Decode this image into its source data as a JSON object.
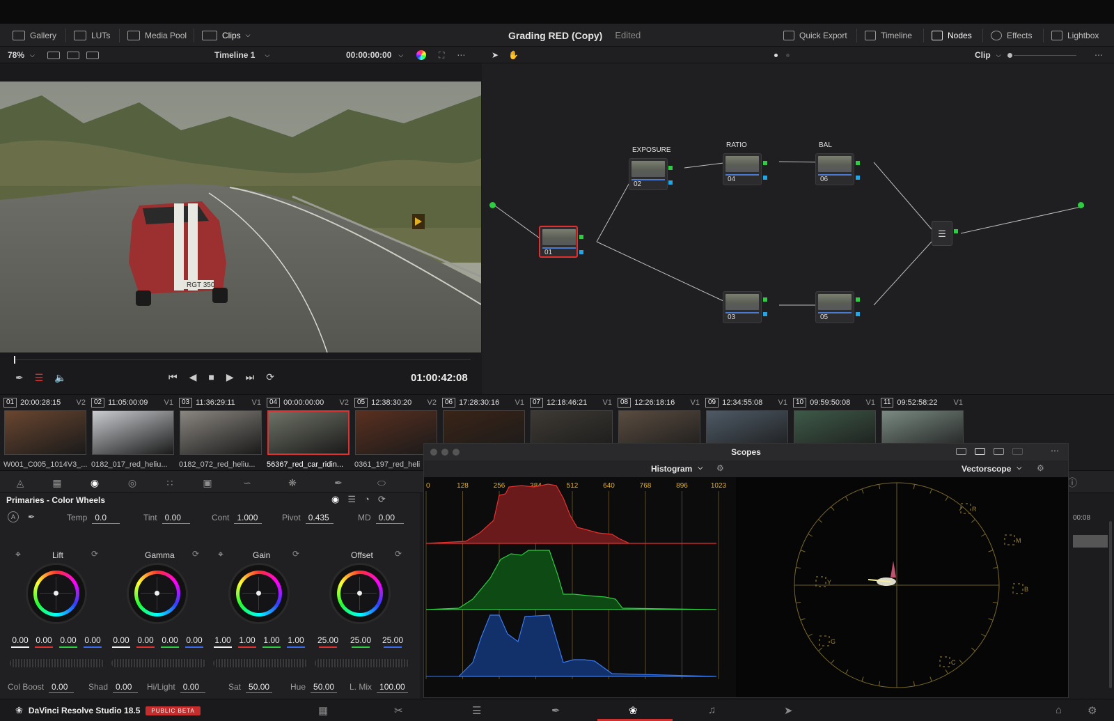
{
  "topbar": {
    "gallery": "Gallery",
    "luts": "LUTs",
    "media_pool": "Media Pool",
    "clips": "Clips",
    "project_title": "Grading RED (Copy)",
    "project_status": "Edited",
    "quick_export": "Quick Export",
    "timeline": "Timeline",
    "nodes": "Nodes",
    "effects": "Effects",
    "lightbox": "Lightbox"
  },
  "viewer": {
    "zoom": "78%",
    "timeline_name": "Timeline 1",
    "source_timecode": "00:00:00:00",
    "current_timecode": "01:00:42:08"
  },
  "nodebar": {
    "mode": "Clip"
  },
  "nodes": [
    {
      "num": "01",
      "label": ""
    },
    {
      "num": "02",
      "label": "EXPOSURE"
    },
    {
      "num": "04",
      "label": "RATIO"
    },
    {
      "num": "06",
      "label": "BAL"
    },
    {
      "num": "03",
      "label": ""
    },
    {
      "num": "05",
      "label": ""
    }
  ],
  "clips": [
    {
      "num": "01",
      "tc": "20:00:28:15",
      "track": "V2",
      "name": "W001_C005_1014V3_..."
    },
    {
      "num": "02",
      "tc": "11:05:00:09",
      "track": "V1",
      "name": "0182_017_red_heliu..."
    },
    {
      "num": "03",
      "tc": "11:36:29:11",
      "track": "V1",
      "name": "0182_072_red_heliu..."
    },
    {
      "num": "04",
      "tc": "00:00:00:00",
      "track": "V2",
      "name": "56367_red_car_ridin..."
    },
    {
      "num": "05",
      "tc": "12:38:30:20",
      "track": "V2",
      "name": "0361_197_red_heli"
    },
    {
      "num": "06",
      "tc": "17:28:30:16",
      "track": "V1",
      "name": ""
    },
    {
      "num": "07",
      "tc": "12:18:46:21",
      "track": "V1",
      "name": ""
    },
    {
      "num": "08",
      "tc": "12:26:18:16",
      "track": "V1",
      "name": ""
    },
    {
      "num": "09",
      "tc": "12:34:55:08",
      "track": "V1",
      "name": ""
    },
    {
      "num": "10",
      "tc": "09:59:50:08",
      "track": "V1",
      "name": ""
    },
    {
      "num": "11",
      "tc": "09:52:58:22",
      "track": "V1",
      "name": ""
    }
  ],
  "primaries": {
    "title": "Primaries - Color Wheels",
    "temp_label": "Temp",
    "temp": "0.0",
    "tint_label": "Tint",
    "tint": "0.00",
    "cont_label": "Cont",
    "cont": "1.000",
    "pivot_label": "Pivot",
    "pivot": "0.435",
    "md_label": "MD",
    "md": "0.00",
    "wheels": [
      {
        "name": "Lift",
        "values": [
          "0.00",
          "0.00",
          "0.00",
          "0.00"
        ]
      },
      {
        "name": "Gamma",
        "values": [
          "0.00",
          "0.00",
          "0.00",
          "0.00"
        ]
      },
      {
        "name": "Gain",
        "values": [
          "1.00",
          "1.00",
          "1.00",
          "1.00"
        ]
      },
      {
        "name": "Offset",
        "values": [
          "25.00",
          "25.00",
          "25.00"
        ]
      }
    ],
    "col_boost_label": "Col Boost",
    "col_boost": "0.00",
    "shad_label": "Shad",
    "shad": "0.00",
    "hilight_label": "Hi/Light",
    "hilight": "0.00",
    "sat_label": "Sat",
    "sat": "50.00",
    "hue_label": "Hue",
    "hue": "50.00",
    "lmix_label": "L. Mix",
    "lmix": "100.00"
  },
  "scopes": {
    "title": "Scopes",
    "left_scope": "Histogram",
    "right_scope": "Vectorscope",
    "ticks": [
      "0",
      "128",
      "256",
      "384",
      "512",
      "640",
      "768",
      "896",
      "1023"
    ],
    "vector_targets": [
      "R",
      "M",
      "B",
      "C",
      "G",
      "Y"
    ]
  },
  "right_panel": {
    "tc": "00:08"
  },
  "status": {
    "app": "DaVinci Resolve Studio 18.5",
    "badge": "PUBLIC BETA"
  },
  "colors": {
    "accent_red": "#e03030",
    "node_green": "#2ecc40",
    "node_blue": "#22a6e8"
  }
}
